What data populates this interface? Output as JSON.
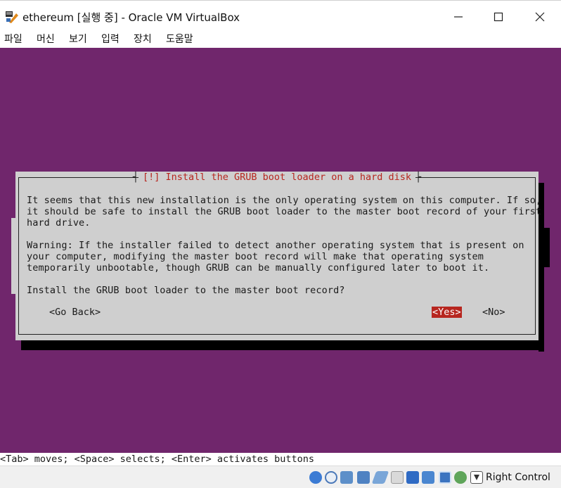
{
  "window": {
    "title": "ethereum [실행 중] - Oracle VM VirtualBox"
  },
  "menu": [
    "파일",
    "머신",
    "보기",
    "입력",
    "장치",
    "도움말"
  ],
  "dialog": {
    "title": "[!] Install the GRUB boot loader on a hard disk",
    "lines": [
      "It seems that this new installation is the only operating system on this computer. If so,",
      "it should be safe to install the GRUB boot loader to the master boot record of your first",
      "hard drive.",
      "",
      "Warning: If the installer failed to detect another operating system that is present on",
      "your computer, modifying the master boot record will make that operating system",
      "temporarily unbootable, though GRUB can be manually configured later to boot it.",
      "",
      "Install the GRUB boot loader to the master boot record?"
    ],
    "buttons": {
      "back": "<Go Back>",
      "yes": "<Yes>",
      "no": "<No>"
    }
  },
  "hint": "<Tab> moves; <Space> selects; <Enter> activates buttons",
  "status": {
    "host_key": "Right Control",
    "icons": [
      "hard-disk-icon",
      "optical-drive-icon",
      "audio-icon",
      "network-icon",
      "usb-icon",
      "shared-folder-icon",
      "display-icon",
      "recording-icon",
      "cpu-icon",
      "mouse-integration-icon",
      "keyboard-icon"
    ]
  },
  "colors": {
    "vm_background": "#70266c",
    "dialog_background": "#cfcfcf",
    "accent_red": "#b7261f"
  }
}
